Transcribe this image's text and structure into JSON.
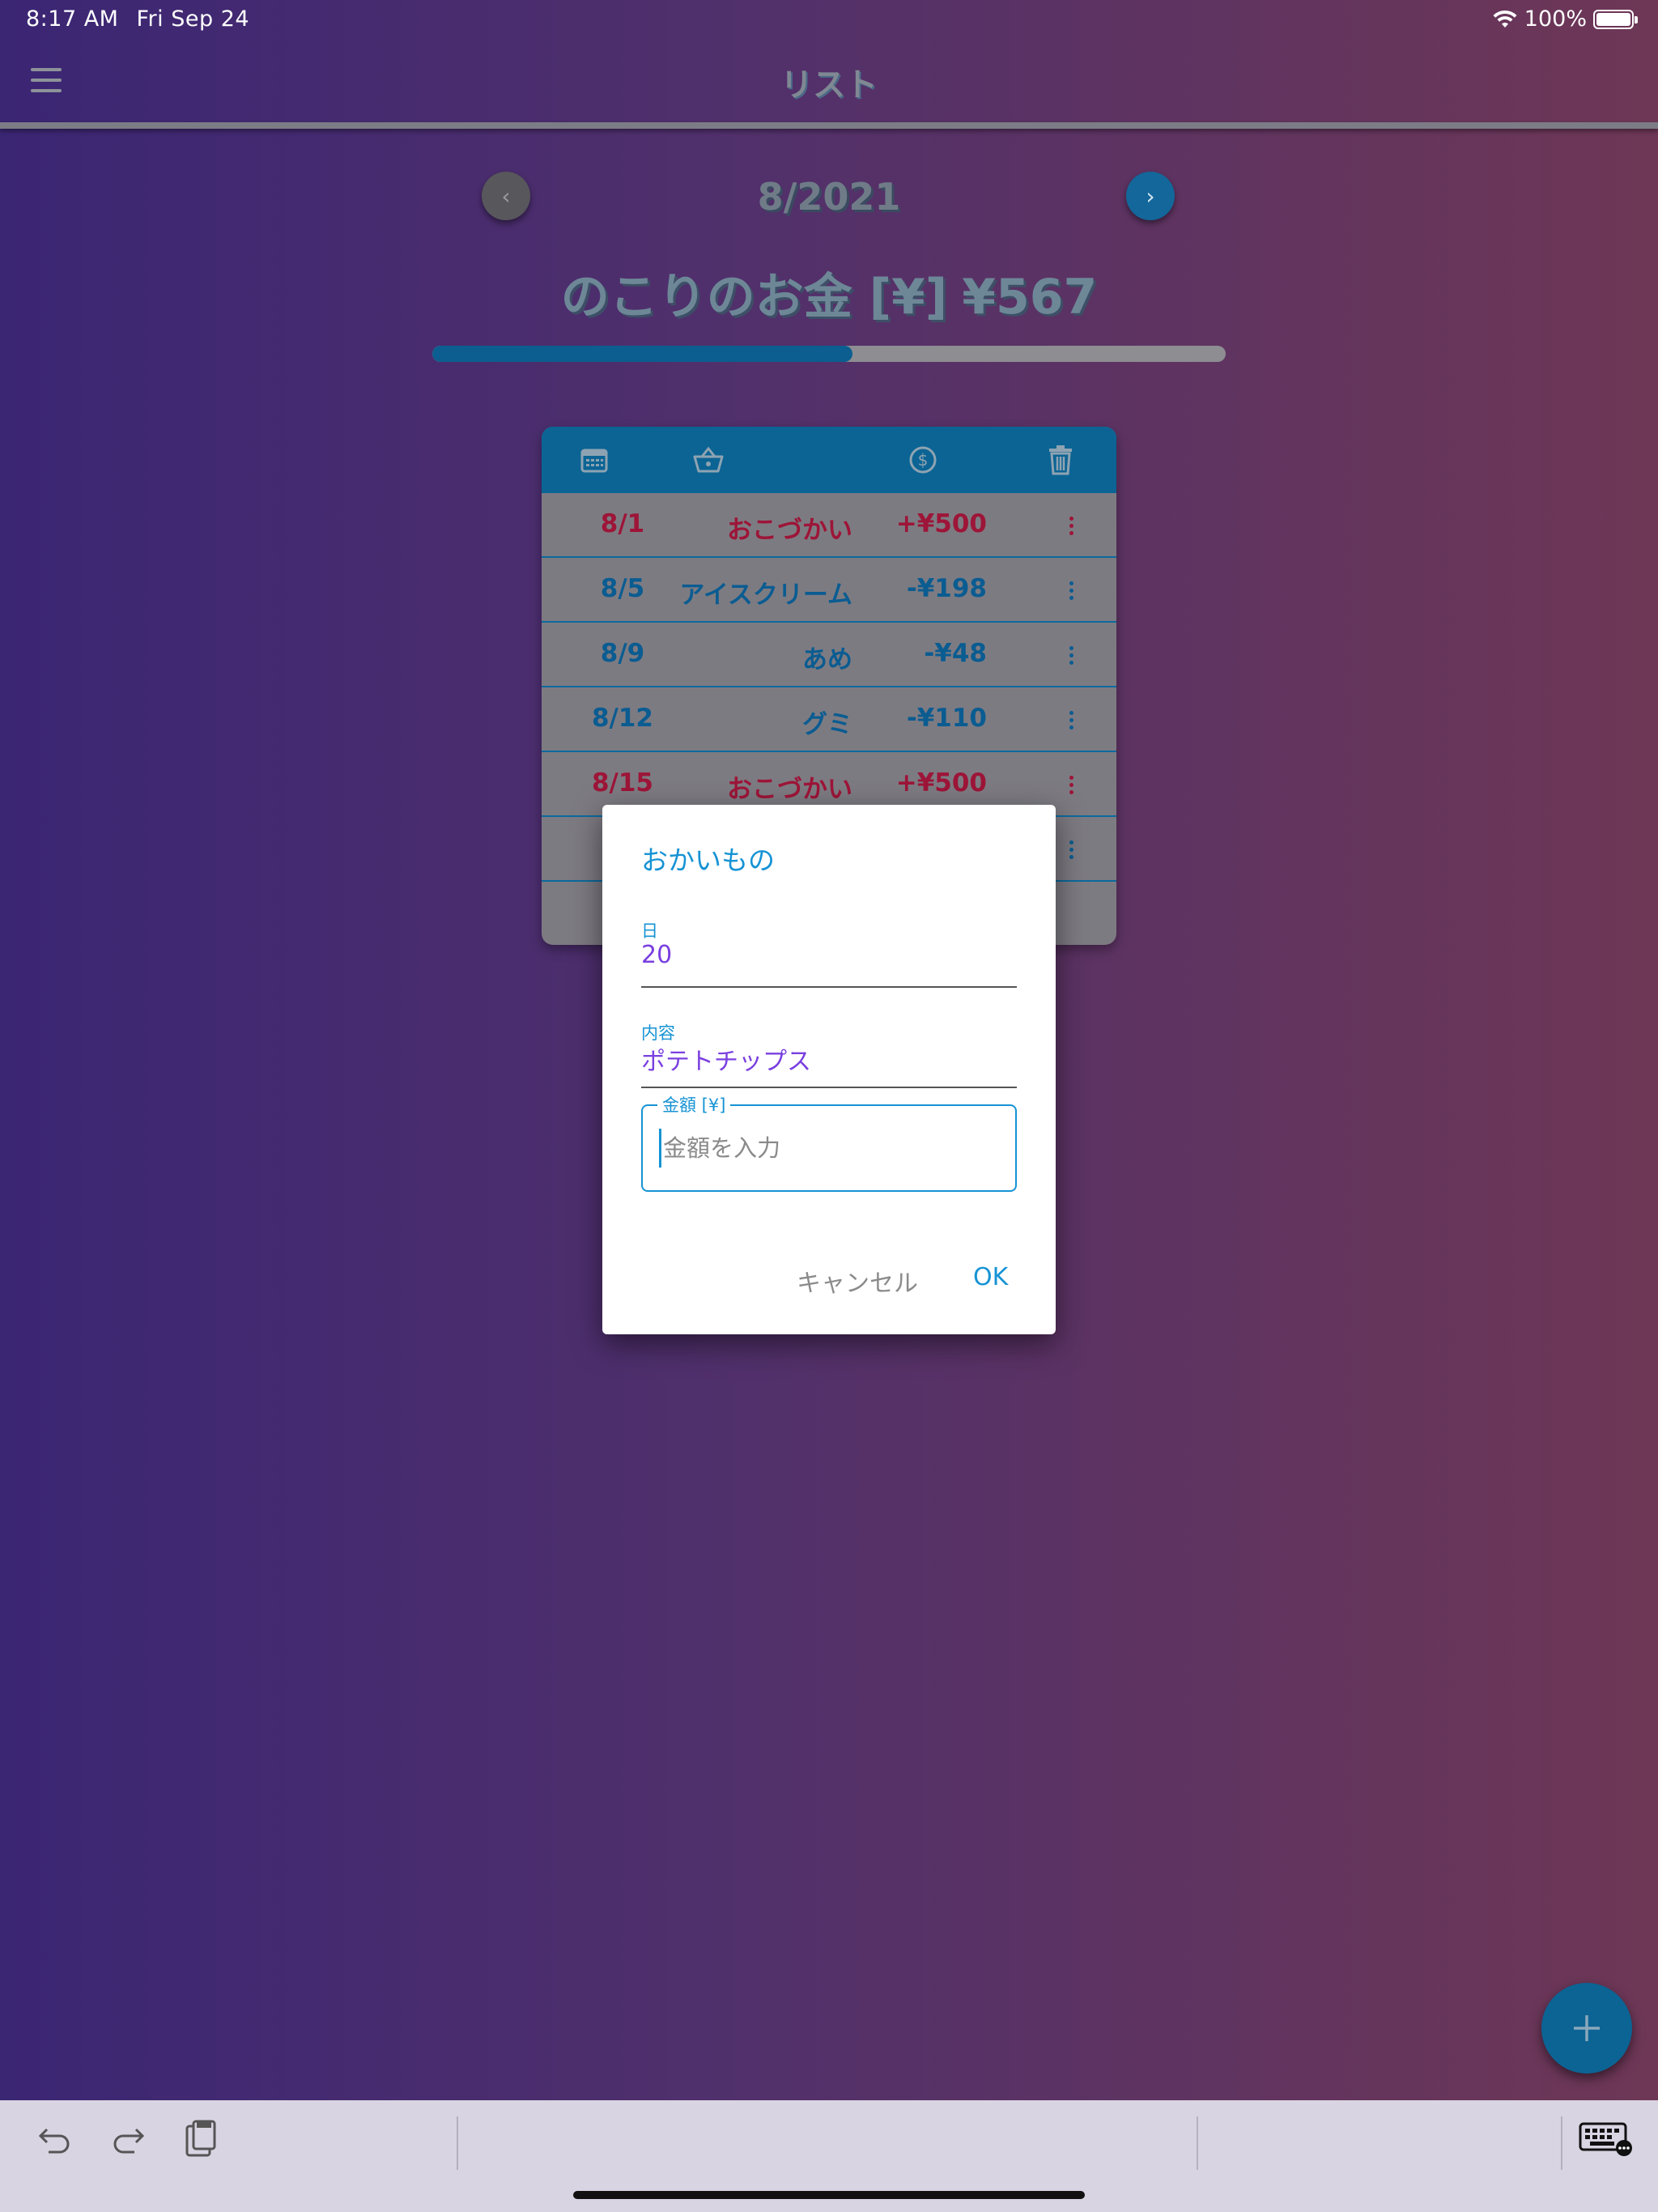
{
  "status_bar": {
    "time": "8:17 AM",
    "date": "Fri Sep 24",
    "battery": "100%"
  },
  "app_bar": {
    "title": "リスト"
  },
  "month_nav": {
    "label": "8/2021"
  },
  "remaining": {
    "label": "のこりのお金 [¥]",
    "amount": "¥567",
    "progress_fraction": 0.53
  },
  "table": {
    "header_icons": [
      "calendar-icon",
      "basket-icon",
      "dollar-icon",
      "trash-icon"
    ],
    "rows": [
      {
        "date": "8/1",
        "item": "おこづかい",
        "amount": "+¥500",
        "type": "plus"
      },
      {
        "date": "8/5",
        "item": "アイスクリーム",
        "amount": "-¥198",
        "type": "minus"
      },
      {
        "date": "8/9",
        "item": "あめ",
        "amount": "-¥48",
        "type": "minus"
      },
      {
        "date": "8/12",
        "item": "グミ",
        "amount": "-¥110",
        "type": "minus"
      },
      {
        "date": "8/15",
        "item": "おこづかい",
        "amount": "+¥500",
        "type": "plus"
      },
      {
        "date": "8/",
        "item": "",
        "amount": "",
        "type": "minus"
      }
    ]
  },
  "dialog": {
    "title": "おかいもの",
    "day_label": "日",
    "day_value": "20",
    "content_label": "内容",
    "content_value": "ポテトチップス",
    "amount_label": "金額 [¥]",
    "amount_placeholder": "金額を入力",
    "cancel_label": "キャンセル",
    "ok_label": "OK"
  },
  "colors": {
    "accent": "#1693d4",
    "header": "#0b6494",
    "plus": "#9d1538",
    "minus": "#0a5c91",
    "value": "#7a3fe0"
  }
}
